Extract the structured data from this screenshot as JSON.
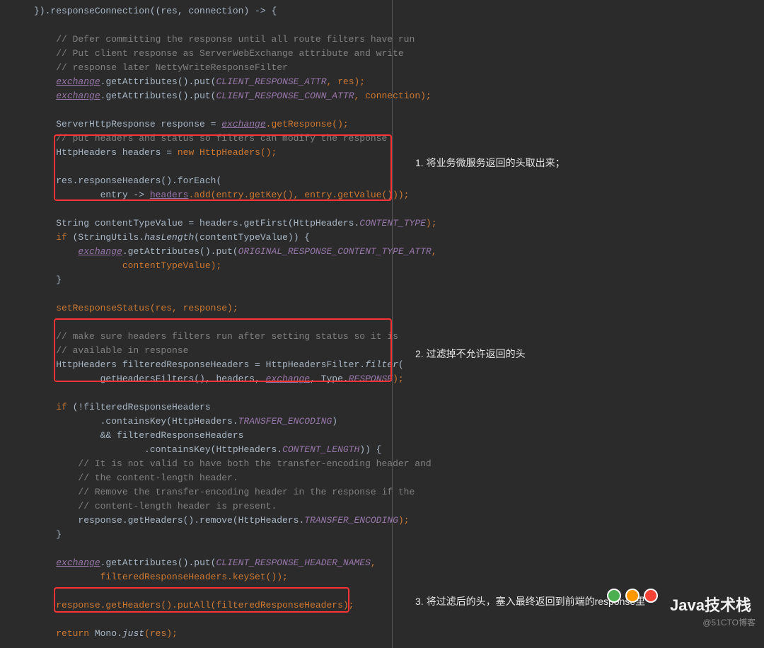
{
  "code": {
    "l01": "}).responseConnection((res, connection) -> {",
    "l02": "",
    "l03": "    // Defer committing the response until all route filters have run",
    "l04": "    // Put client response as ServerWebExchange attribute and write",
    "l05": "    // response later NettyWriteResponseFilter",
    "l06a": "    ",
    "l06_exchange": "exchange",
    "l06b": ".getAttributes().put(",
    "l06_attr": "CLIENT_RESPONSE_ATTR",
    "l06c": ", res);",
    "l07a": "    ",
    "l07_exchange": "exchange",
    "l07b": ".getAttributes().put(",
    "l07_attr": "CLIENT_RESPONSE_CONN_ATTR",
    "l07c": ", connection);",
    "l08": "",
    "l09a": "    ServerHttpResponse response = ",
    "l09_exchange": "exchange",
    "l09b": ".getResponse();",
    "l10": "    // put headers and status so filters can modify the response",
    "l11a": "    HttpHeaders headers = ",
    "l11_new": "new",
    "l11b": " HttpHeaders();",
    "l12": "",
    "l13": "    res.responseHeaders().forEach(",
    "l14a": "            entry -> ",
    "l14_headers": "headers",
    "l14b": ".add(entry.getKey(), entry.getValue()));",
    "l15": "",
    "l16a": "    String contentTypeValue = headers.getFirst(HttpHeaders.",
    "l16_ct": "CONTENT_TYPE",
    "l16b": ");",
    "l17a": "    ",
    "l17_if": "if",
    "l17b": " (StringUtils.",
    "l17_hl": "hasLength",
    "l17c": "(contentTypeValue)) {",
    "l18a": "        ",
    "l18_exchange": "exchange",
    "l18b": ".getAttributes().put(",
    "l18_attr": "ORIGINAL_RESPONSE_CONTENT_TYPE_ATTR",
    "l18c": ",",
    "l19": "                contentTypeValue);",
    "l20": "    }",
    "l21": "",
    "l22": "    setResponseStatus(res, response);",
    "l23": "",
    "l24": "    // make sure headers filters run after setting status so it is",
    "l25": "    // available in response",
    "l26a": "    HttpHeaders filteredResponseHeaders = HttpHeadersFilter.",
    "l26_filter": "filter",
    "l26b": "(",
    "l27a": "            getHeadersFilters(), headers, ",
    "l27_exchange": "exchange",
    "l27b": ", Type.",
    "l27_resp": "RESPONSE",
    "l27c": ");",
    "l28": "",
    "l29a": "    ",
    "l29_if": "if",
    "l29b": " (!filteredResponseHeaders",
    "l30a": "            .containsKey(HttpHeaders.",
    "l30_te": "TRANSFER_ENCODING",
    "l30b": ")",
    "l31": "            && filteredResponseHeaders",
    "l32a": "                    .containsKey(HttpHeaders.",
    "l32_cl": "CONTENT_LENGTH",
    "l32b": ")) {",
    "l33": "        // It is not valid to have both the transfer-encoding header and",
    "l34": "        // the content-length header.",
    "l35": "        // Remove the transfer-encoding header in the response if the",
    "l36": "        // content-length header is present.",
    "l37a": "        response.getHeaders().remove(HttpHeaders.",
    "l37_te": "TRANSFER_ENCODING",
    "l37b": ");",
    "l38": "    }",
    "l39": "",
    "l40a": "    ",
    "l40_exchange": "exchange",
    "l40b": ".getAttributes().put(",
    "l40_attr": "CLIENT_RESPONSE_HEADER_NAMES",
    "l40c": ",",
    "l41": "            filteredResponseHeaders.keySet());",
    "l42": "",
    "l43": "    response.getHeaders().putAll(filteredResponseHeaders);",
    "l44": "",
    "l45a": "    ",
    "l45_return": "return",
    "l45b": " Mono.",
    "l45_just": "just",
    "l45c": "(res);"
  },
  "annotations": {
    "a1": "1. 将业务微服务返回的头取出来；",
    "a2": "2. 过滤掉不允许返回的头",
    "a3": "3. 将过滤后的头，塞入最终返回到前端的response里"
  },
  "watermark": {
    "java": "Java技术栈",
    "cto": "@51CTO博客"
  }
}
